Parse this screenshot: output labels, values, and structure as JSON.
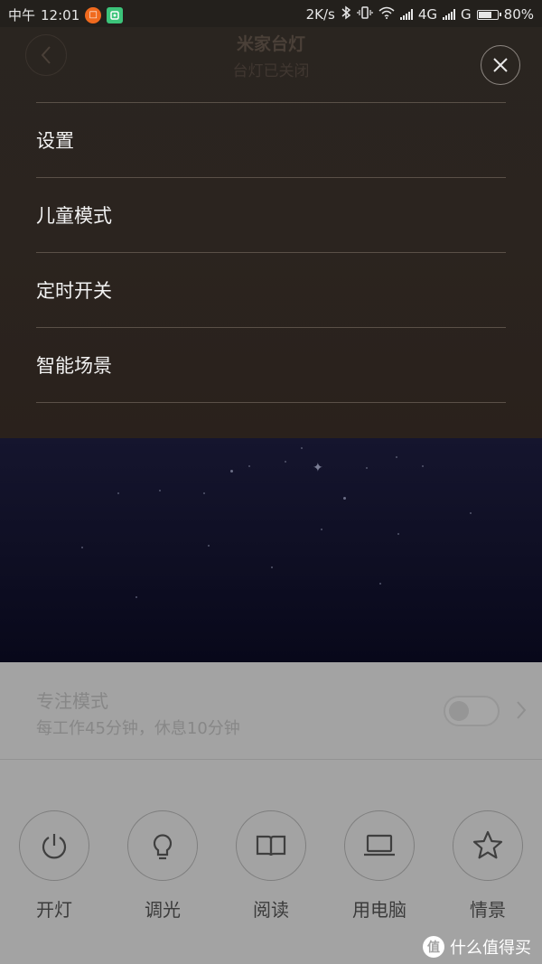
{
  "status_bar": {
    "time_label": "中午",
    "time": "12:01",
    "speed": "2K/s",
    "net_4g": "4G",
    "net_g": "G",
    "battery_percent": "80%",
    "battery_level": 0.8
  },
  "app": {
    "title": "米家台灯",
    "subtitle": "台灯已关闭"
  },
  "menu": {
    "items": [
      {
        "label": "设置"
      },
      {
        "label": "儿童模式"
      },
      {
        "label": "定时开关"
      },
      {
        "label": "智能场景"
      }
    ]
  },
  "focus_mode": {
    "title": "专注模式",
    "description": "每工作45分钟，休息10分钟",
    "enabled": false
  },
  "controls": [
    {
      "label": "开灯",
      "icon": "power-icon"
    },
    {
      "label": "调光",
      "icon": "bulb-icon"
    },
    {
      "label": "阅读",
      "icon": "book-icon"
    },
    {
      "label": "用电脑",
      "icon": "laptop-icon"
    },
    {
      "label": "情景",
      "icon": "star-icon"
    }
  ],
  "watermark": {
    "logo_char": "值",
    "text": "什么值得买"
  }
}
